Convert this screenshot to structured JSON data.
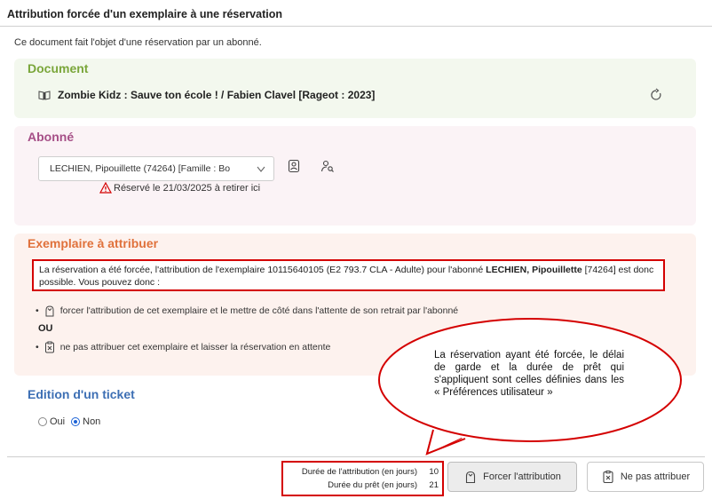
{
  "dialog": {
    "title": "Attribution forcée d'un exemplaire à une réservation",
    "intro": "Ce document fait l'objet d'une réservation par un abonné."
  },
  "document": {
    "section_title": "Document",
    "title": "Zombie Kidz : Sauve ton école ! / Fabien Clavel [Rageot : 2023]",
    "icon": "book-icon",
    "action_icon": "refresh-icon"
  },
  "abonne": {
    "section_title": "Abonné",
    "select_value": "LECHIEN, Pipouillette (74264) [Famille : Bo",
    "warning": "Réservé le 21/03/2025 à retirer ici",
    "icons": [
      "id-card-icon",
      "user-search-icon"
    ]
  },
  "exemplaire": {
    "section_title": "Exemplaire à attribuer",
    "message_part1": "La réservation a été forcée, l'attribution de l'exemplaire 10115640105 (E2 793.7 CLA - Adulte) pour l'abonné ",
    "message_bold": "LECHIEN, Pipouillette",
    "message_part2": " [74264] est donc possible. Vous pouvez donc :",
    "option1": "forcer l'attribution de cet exemplaire et le mettre de côté dans l'attente de son retrait par l'abonné",
    "or_label": "ou",
    "option2": "ne pas attribuer cet exemplaire et laisser la réservation en attente"
  },
  "ticket": {
    "section_title": "Edition d'un ticket",
    "options": [
      "Oui",
      "Non"
    ],
    "selected": "Non"
  },
  "durations": {
    "attribution_label": "Durée de l'attribution (en jours)",
    "attribution_value": "10",
    "pret_label": "Durée du prêt (en jours)",
    "pret_value": "21"
  },
  "buttons": {
    "force": "Forcer l'attribution",
    "skip": "Ne pas attribuer"
  },
  "callout": {
    "text": "La réservation ayant été forcée, le délai de garde et la durée de prêt qui s'appliquent sont celles définies dans les « Préférences utilisateur »"
  },
  "colors": {
    "document_green": "#7aa63a",
    "abonne_purple": "#a64f87",
    "exemplaire_orange": "#e0713b",
    "ticket_blue": "#3d6fb4",
    "highlight_red": "#d40000"
  }
}
